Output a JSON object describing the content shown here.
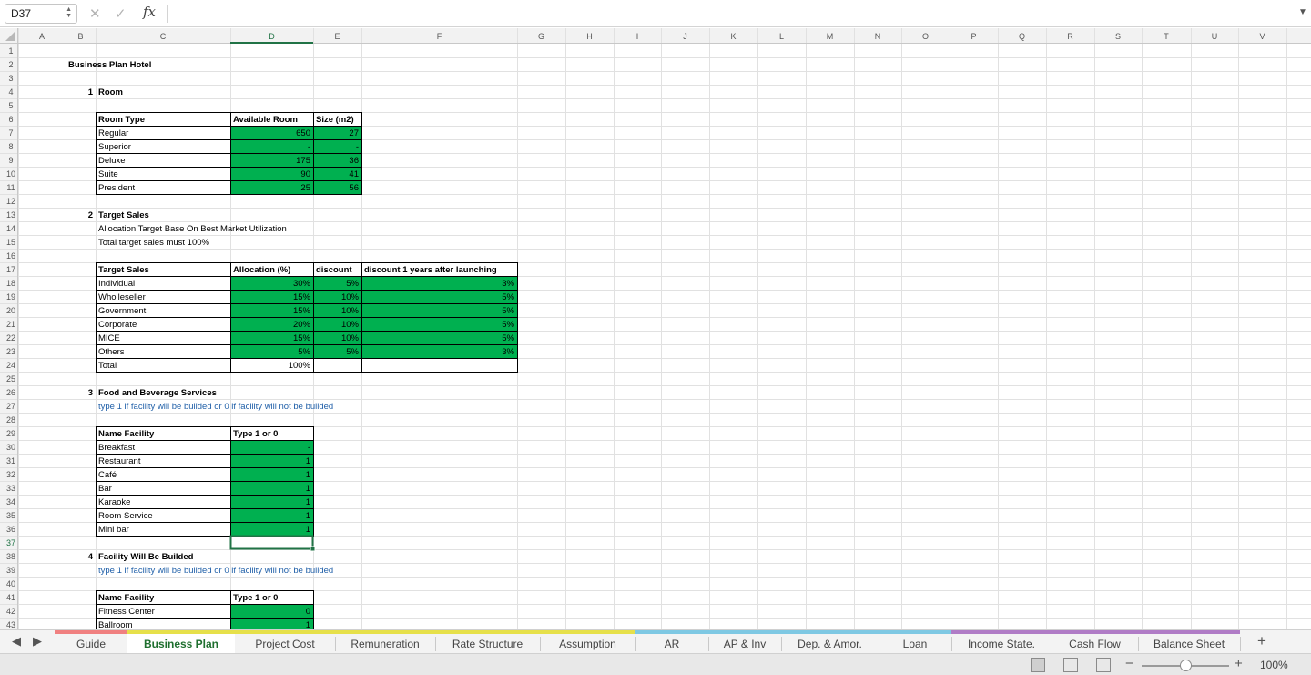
{
  "formula_bar": {
    "cell_ref": "D37",
    "fx_label": "fx",
    "formula": ""
  },
  "columns": [
    "A",
    "B",
    "C",
    "D",
    "E",
    "F",
    "G",
    "H",
    "I",
    "J",
    "K",
    "L",
    "M",
    "N",
    "O",
    "P",
    "Q",
    "R",
    "S",
    "T",
    "U",
    "V"
  ],
  "rows": [
    1,
    2,
    3,
    4,
    5,
    6,
    7,
    8,
    9,
    10,
    11,
    12,
    13,
    14,
    15,
    16,
    17,
    18,
    19,
    20,
    21,
    22,
    23,
    24,
    25,
    26,
    27,
    28,
    29,
    30,
    31,
    32,
    33,
    34,
    35,
    36,
    37,
    38,
    39,
    40,
    41,
    42,
    43
  ],
  "selected": {
    "col": "D",
    "row": 37
  },
  "colors": {
    "input_fill": "#00b050",
    "note_text": "#1f5fa8",
    "active_tab_text": "#1f6f2f",
    "selection": "#217346"
  },
  "cells": [
    {
      "ref": "B2",
      "text": "Business Plan Hotel",
      "bold": true
    },
    {
      "ref": "B4",
      "text": "1",
      "bold": true,
      "align": "right"
    },
    {
      "ref": "C4",
      "text": "Room",
      "bold": true
    },
    {
      "ref": "C6",
      "text": "Room Type",
      "bold": true
    },
    {
      "ref": "D6",
      "text": "Available Room",
      "bold": true
    },
    {
      "ref": "E6",
      "text": "Size (m2)",
      "bold": true
    },
    {
      "ref": "C7",
      "text": "Regular"
    },
    {
      "ref": "D7",
      "text": "650",
      "align": "right",
      "fill": "green"
    },
    {
      "ref": "E7",
      "text": "27",
      "align": "right",
      "fill": "green"
    },
    {
      "ref": "C8",
      "text": "Superior"
    },
    {
      "ref": "D8",
      "text": "-",
      "align": "right",
      "fill": "green"
    },
    {
      "ref": "E8",
      "text": "-",
      "align": "right",
      "fill": "green"
    },
    {
      "ref": "C9",
      "text": "Deluxe"
    },
    {
      "ref": "D9",
      "text": "175",
      "align": "right",
      "fill": "green"
    },
    {
      "ref": "E9",
      "text": "36",
      "align": "right",
      "fill": "green"
    },
    {
      "ref": "C10",
      "text": "Suite"
    },
    {
      "ref": "D10",
      "text": "90",
      "align": "right",
      "fill": "green"
    },
    {
      "ref": "E10",
      "text": "41",
      "align": "right",
      "fill": "green"
    },
    {
      "ref": "C11",
      "text": "President"
    },
    {
      "ref": "D11",
      "text": "25",
      "align": "right",
      "fill": "green"
    },
    {
      "ref": "E11",
      "text": "56",
      "align": "right",
      "fill": "green"
    },
    {
      "ref": "B13",
      "text": "2",
      "bold": true,
      "align": "right"
    },
    {
      "ref": "C13",
      "text": "Target Sales",
      "bold": true
    },
    {
      "ref": "C14",
      "text": "Allocation Target Base On Best Market Utilization"
    },
    {
      "ref": "C15",
      "text": "Total target sales must 100%"
    },
    {
      "ref": "C17",
      "text": "Target Sales",
      "bold": true
    },
    {
      "ref": "D17",
      "text": "Allocation (%)",
      "bold": true
    },
    {
      "ref": "E17",
      "text": "discount",
      "bold": true
    },
    {
      "ref": "F17",
      "text": "discount 1 years after launching",
      "bold": true
    },
    {
      "ref": "C18",
      "text": "Individual"
    },
    {
      "ref": "D18",
      "text": "30%",
      "align": "right",
      "fill": "green"
    },
    {
      "ref": "E18",
      "text": "5%",
      "align": "right",
      "fill": "green"
    },
    {
      "ref": "F18",
      "text": "3%",
      "align": "right",
      "fill": "green"
    },
    {
      "ref": "C19",
      "text": "Wholleseller"
    },
    {
      "ref": "D19",
      "text": "15%",
      "align": "right",
      "fill": "green"
    },
    {
      "ref": "E19",
      "text": "10%",
      "align": "right",
      "fill": "green"
    },
    {
      "ref": "F19",
      "text": "5%",
      "align": "right",
      "fill": "green"
    },
    {
      "ref": "C20",
      "text": "Government"
    },
    {
      "ref": "D20",
      "text": "15%",
      "align": "right",
      "fill": "green"
    },
    {
      "ref": "E20",
      "text": "10%",
      "align": "right",
      "fill": "green"
    },
    {
      "ref": "F20",
      "text": "5%",
      "align": "right",
      "fill": "green"
    },
    {
      "ref": "C21",
      "text": "Corporate"
    },
    {
      "ref": "D21",
      "text": "20%",
      "align": "right",
      "fill": "green"
    },
    {
      "ref": "E21",
      "text": "10%",
      "align": "right",
      "fill": "green"
    },
    {
      "ref": "F21",
      "text": "5%",
      "align": "right",
      "fill": "green"
    },
    {
      "ref": "C22",
      "text": "MICE"
    },
    {
      "ref": "D22",
      "text": "15%",
      "align": "right",
      "fill": "green"
    },
    {
      "ref": "E22",
      "text": "10%",
      "align": "right",
      "fill": "green"
    },
    {
      "ref": "F22",
      "text": "5%",
      "align": "right",
      "fill": "green"
    },
    {
      "ref": "C23",
      "text": "Others"
    },
    {
      "ref": "D23",
      "text": "5%",
      "align": "right",
      "fill": "green"
    },
    {
      "ref": "E23",
      "text": "5%",
      "align": "right",
      "fill": "green"
    },
    {
      "ref": "F23",
      "text": "3%",
      "align": "right",
      "fill": "green"
    },
    {
      "ref": "C24",
      "text": "Total"
    },
    {
      "ref": "D24",
      "text": "100%",
      "align": "right"
    },
    {
      "ref": "E24",
      "text": ""
    },
    {
      "ref": "F24",
      "text": ""
    },
    {
      "ref": "B26",
      "text": "3",
      "bold": true,
      "align": "right"
    },
    {
      "ref": "C26",
      "text": "Food and Beverage Services",
      "bold": true
    },
    {
      "ref": "C27",
      "text": "type 1 if facility will be builded or 0 if facility will not be builded",
      "note": true
    },
    {
      "ref": "C29",
      "text": "Name Facility",
      "bold": true
    },
    {
      "ref": "D29",
      "text": "Type 1 or 0",
      "bold": true
    },
    {
      "ref": "C30",
      "text": "Breakfast"
    },
    {
      "ref": "D30",
      "text": "-",
      "align": "right",
      "fill": "green"
    },
    {
      "ref": "C31",
      "text": "Restaurant"
    },
    {
      "ref": "D31",
      "text": "1",
      "align": "right",
      "fill": "green"
    },
    {
      "ref": "C32",
      "text": "Café"
    },
    {
      "ref": "D32",
      "text": "1",
      "align": "right",
      "fill": "green"
    },
    {
      "ref": "C33",
      "text": "Bar"
    },
    {
      "ref": "D33",
      "text": "1",
      "align": "right",
      "fill": "green"
    },
    {
      "ref": "C34",
      "text": "Karaoke"
    },
    {
      "ref": "D34",
      "text": "1",
      "align": "right",
      "fill": "green"
    },
    {
      "ref": "C35",
      "text": "Room Service"
    },
    {
      "ref": "D35",
      "text": "1",
      "align": "right",
      "fill": "green"
    },
    {
      "ref": "C36",
      "text": "Mini bar"
    },
    {
      "ref": "D36",
      "text": "1",
      "align": "right",
      "fill": "green"
    },
    {
      "ref": "B38",
      "text": "4",
      "bold": true,
      "align": "right"
    },
    {
      "ref": "C38",
      "text": "Facility Will Be Builded",
      "bold": true
    },
    {
      "ref": "C39",
      "text": "type 1 if facility will be builded or 0 if facility will not be builded",
      "note": true
    },
    {
      "ref": "C41",
      "text": "Name Facility",
      "bold": true
    },
    {
      "ref": "D41",
      "text": "Type 1 or 0",
      "bold": true
    },
    {
      "ref": "C42",
      "text": "Fitness Center"
    },
    {
      "ref": "D42",
      "text": "0",
      "align": "right",
      "fill": "green"
    },
    {
      "ref": "C43",
      "text": "Ballroom"
    },
    {
      "ref": "D43",
      "text": "1",
      "align": "right",
      "fill": "green"
    }
  ],
  "bordered_ranges": [
    "C6:E11",
    "C17:F24",
    "C29:D36",
    "C41:D43"
  ],
  "sheet_tabs": [
    {
      "label": "Guide",
      "color": "#f08080"
    },
    {
      "label": "Business Plan",
      "color": "#e6e04a",
      "active": true
    },
    {
      "label": "Project Cost",
      "color": "#e6e04a"
    },
    {
      "label": "Remuneration",
      "color": "#e6e04a"
    },
    {
      "label": "Rate Structure",
      "color": "#e6e04a"
    },
    {
      "label": "Assumption",
      "color": "#e6e04a"
    },
    {
      "label": "AR",
      "color": "#7ec8e3"
    },
    {
      "label": "AP & Inv",
      "color": "#7ec8e3"
    },
    {
      "label": "Dep. & Amor.",
      "color": "#7ec8e3"
    },
    {
      "label": "Loan",
      "color": "#7ec8e3"
    },
    {
      "label": "Income State.",
      "color": "#b07cc6"
    },
    {
      "label": "Cash Flow",
      "color": "#b07cc6"
    },
    {
      "label": "Balance Sheet",
      "color": "#b07cc6"
    }
  ],
  "status": {
    "zoom": "100%",
    "zoom_level": 1.0,
    "view_icons": [
      "normal-view-icon",
      "page-layout-view-icon",
      "page-break-view-icon"
    ]
  }
}
